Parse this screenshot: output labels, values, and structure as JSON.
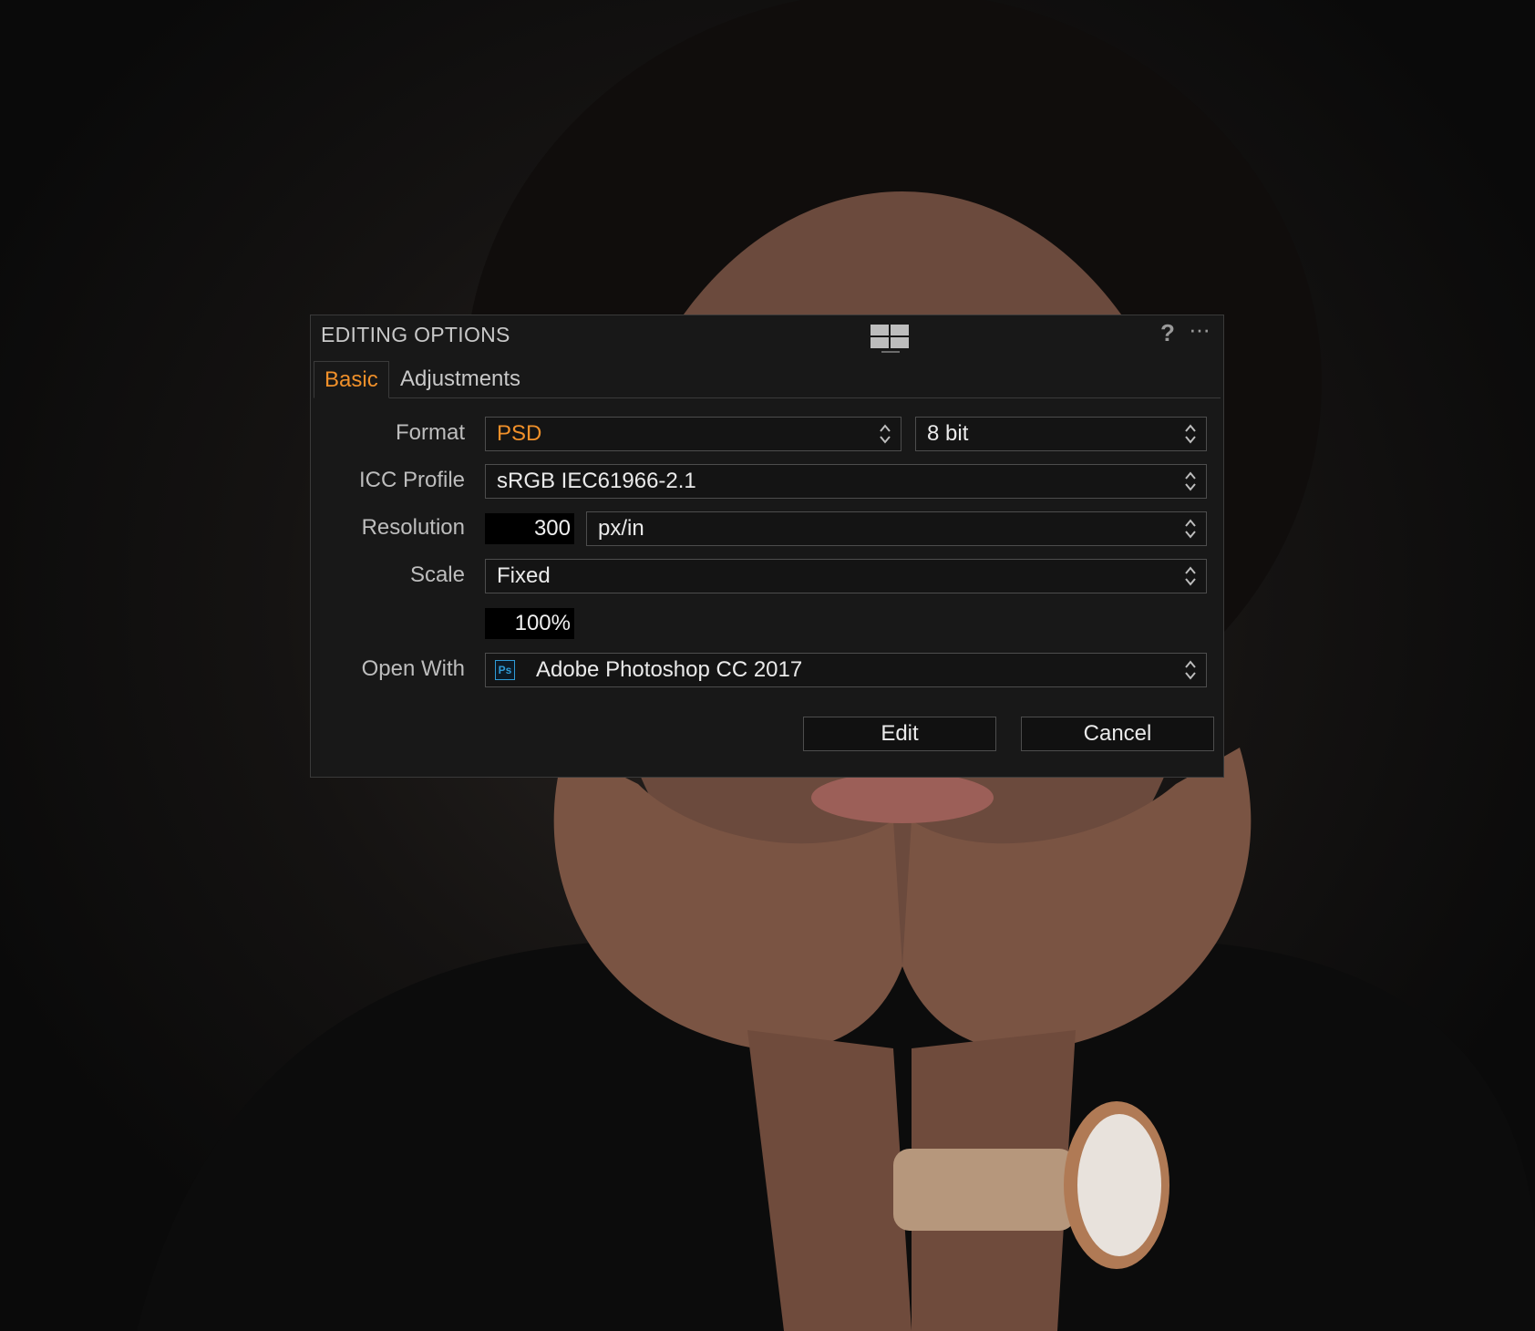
{
  "dialog": {
    "title": "EDITING OPTIONS",
    "help_label": "?",
    "more_label": "···",
    "layout_icon": "layout-grid-icon"
  },
  "tabs": [
    {
      "label": "Basic",
      "active": true
    },
    {
      "label": "Adjustments",
      "active": false
    }
  ],
  "form": {
    "format": {
      "label": "Format",
      "value": "PSD",
      "bit_depth": "8 bit"
    },
    "icc_profile": {
      "label": "ICC Profile",
      "value": "sRGB IEC61966-2.1"
    },
    "resolution": {
      "label": "Resolution",
      "value": "300",
      "unit": "px/in"
    },
    "scale": {
      "label": "Scale",
      "value": "Fixed",
      "percent": "100%"
    },
    "open_with": {
      "label": "Open With",
      "app_icon_text": "Ps",
      "value": "Adobe Photoshop CC 2017"
    }
  },
  "buttons": {
    "edit": "Edit",
    "cancel": "Cancel"
  },
  "colors": {
    "accent": "#f0902a",
    "dialog_bg": "#181818",
    "border": "#4d4d4d",
    "ps_blue": "#2f9bd6"
  }
}
